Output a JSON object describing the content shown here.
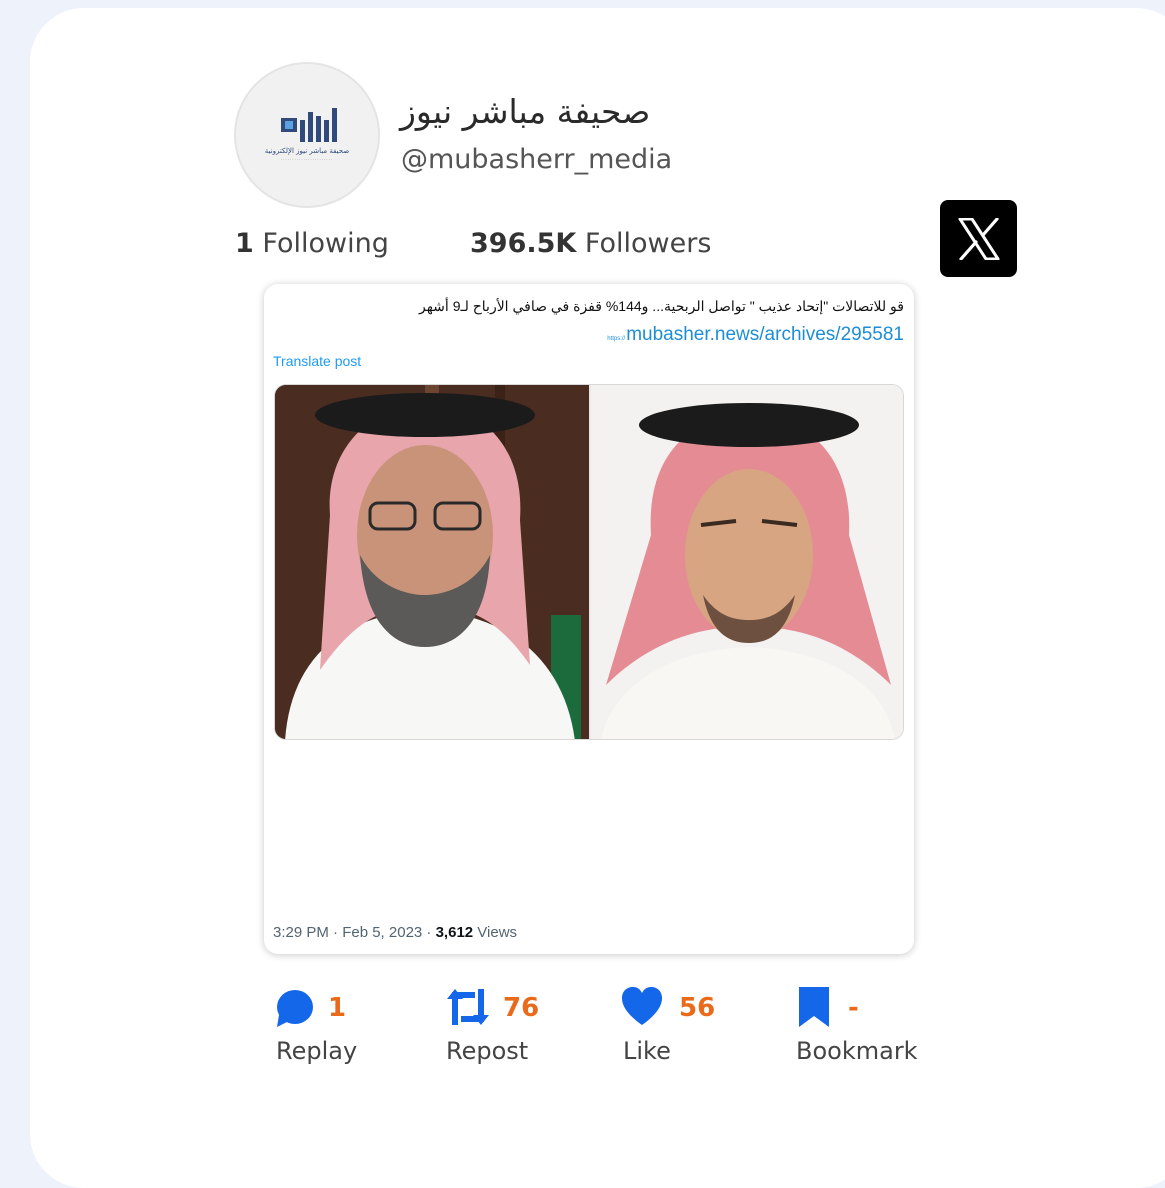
{
  "profile": {
    "display_name": "صحيفة مباشر نيوز",
    "handle": "@mubasherr_media",
    "following_count": "1",
    "following_label": "Following",
    "followers_count": "396.5K",
    "followers_label": "Followers",
    "avatar_logo_text": "مباشر",
    "avatar_sub_text": "صحيفة مباشر نيوز الإلكترونية"
  },
  "platform_icon": "x-logo-icon",
  "tweet": {
    "text": "قو للاتصالات \"إتحاد عذيب \" تواصل الربحية... و144% قفزة في صافي الأرباح لـ9 أشهر",
    "link_prefix": "https://",
    "link": "mubasher.news/archives/295581",
    "translate_label": "Translate post",
    "time": "3:29 PM · Feb 5, 2023 · ",
    "views_count": "3,612",
    "views_label": " Views"
  },
  "actions": [
    {
      "icon": "comment-bubble-icon",
      "count": "1",
      "label": "Replay"
    },
    {
      "icon": "repost-icon",
      "count": "76",
      "label": "Repost"
    },
    {
      "icon": "heart-icon",
      "count": "56",
      "label": "Like"
    },
    {
      "icon": "bookmark-icon",
      "count": "-",
      "label": "Bookmark"
    }
  ],
  "colors": {
    "accent_blue": "#1d8ed6",
    "count_orange": "#ea6a1b",
    "background": "#eef2fb"
  }
}
